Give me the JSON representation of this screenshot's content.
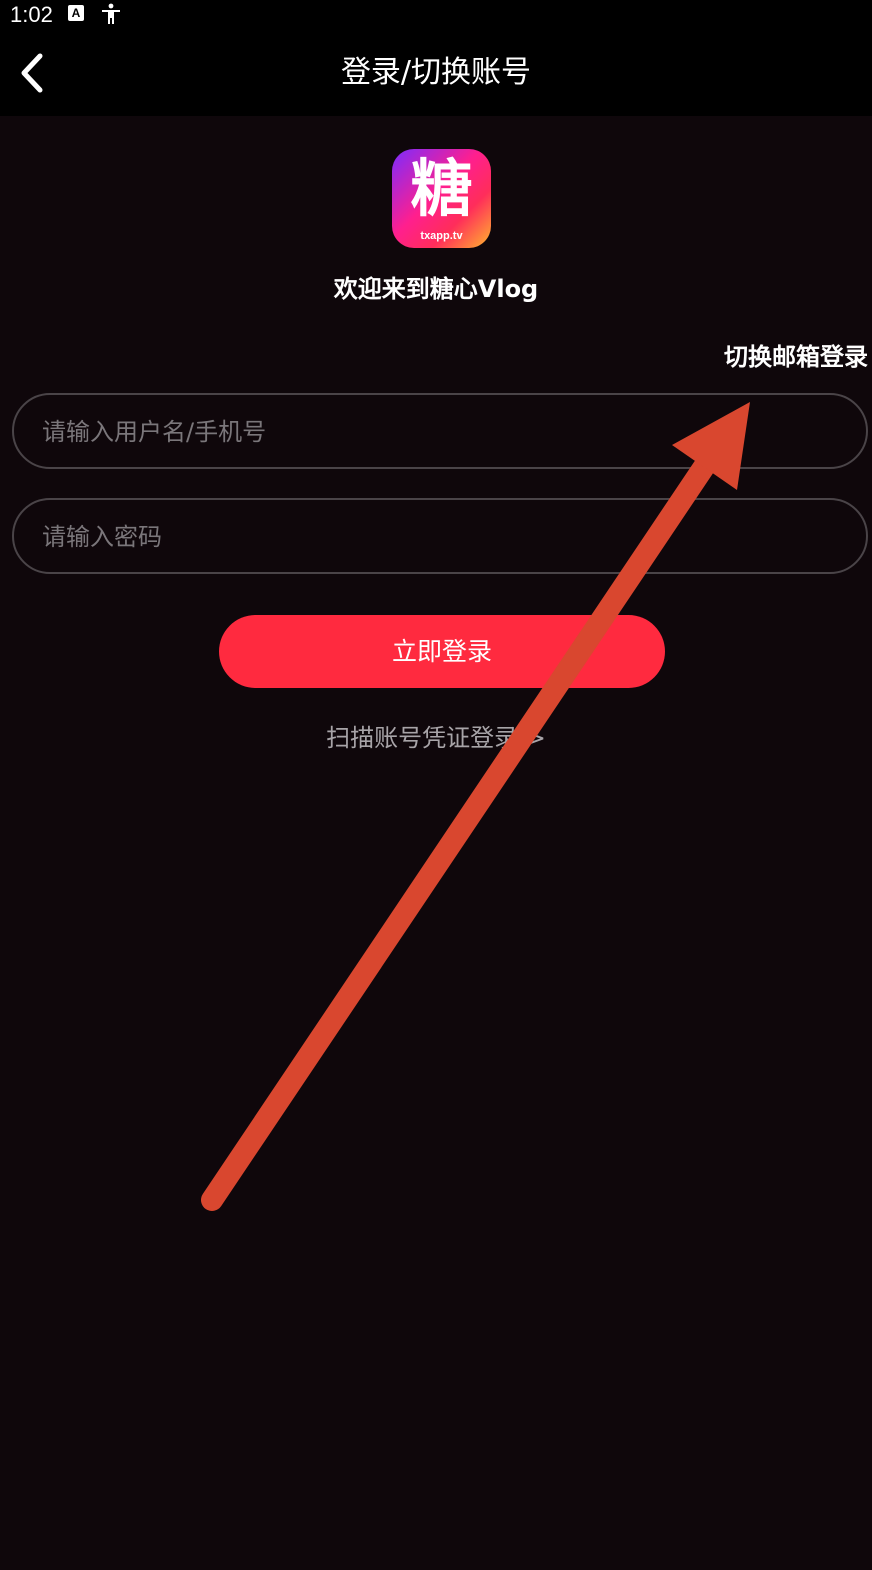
{
  "status_bar": {
    "time": "1:02",
    "icons": [
      "keyboard-a-icon",
      "accessibility-icon"
    ]
  },
  "header": {
    "title": "登录/切换账号",
    "back_icon": "chevron-left-icon"
  },
  "logo": {
    "char": "糖",
    "sub": "txapp.tv"
  },
  "welcome": "欢迎来到糖心Vlog",
  "switch_email": "切换邮箱登录",
  "form": {
    "username_placeholder": "请输入用户名/手机号",
    "password_placeholder": "请输入密码",
    "login_label": "立即登录",
    "scan_label": "扫描账号凭证登录 >"
  },
  "colors": {
    "background": "#0f070b",
    "header": "#000000",
    "primary_button": "#ff2a3f",
    "annotation_arrow": "#d9472f"
  }
}
